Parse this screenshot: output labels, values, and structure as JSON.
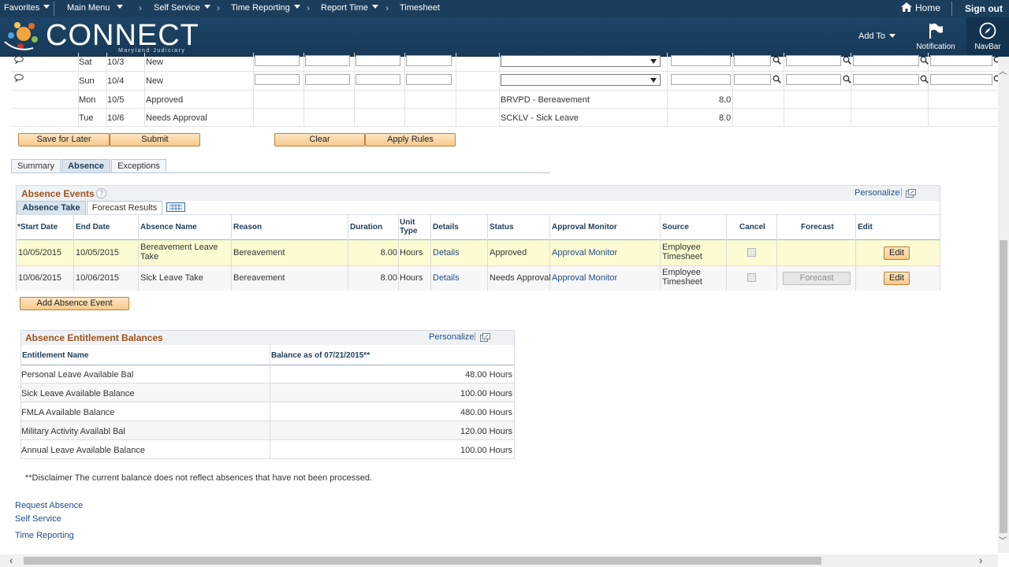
{
  "topnav": {
    "favorites": "Favorites",
    "main_menu": "Main Menu",
    "crumbs": [
      "Self Service",
      "Time Reporting",
      "Report Time",
      "Timesheet"
    ],
    "home": "Home",
    "sign_out": "Sign out"
  },
  "banner": {
    "logo": "CONNECT",
    "logo_sub": "Maryland Judiciary",
    "add_to": "Add To",
    "notification": "Notification",
    "navbar": "NavBar"
  },
  "timesheet_rows": [
    {
      "day": "Sat",
      "date": "10/3",
      "status": "New",
      "editable": true,
      "trc": "",
      "quantity": ""
    },
    {
      "day": "Sun",
      "date": "10/4",
      "status": "New",
      "editable": true,
      "trc": "",
      "quantity": ""
    },
    {
      "day": "Mon",
      "date": "10/5",
      "status": "Approved",
      "editable": false,
      "trc": "BRVPD - Bereavement",
      "quantity": "8.0"
    },
    {
      "day": "Tue",
      "date": "10/6",
      "status": "Needs Approval",
      "editable": false,
      "trc": "SCKLV - Sick Leave",
      "quantity": "8.0"
    }
  ],
  "actions": {
    "save_for_later": "Save for Later",
    "submit": "Submit",
    "clear": "Clear",
    "apply_rules": "Apply Rules"
  },
  "page_tabs": [
    "Summary",
    "Absence",
    "Exceptions"
  ],
  "absence_events": {
    "title": "Absence Events",
    "personalize": "Personalize",
    "subtabs": [
      "Absence Take",
      "Forecast Results"
    ],
    "columns": {
      "start_date": "*Start Date",
      "end_date": "End Date",
      "absence_name": "Absence Name",
      "reason": "Reason",
      "duration": "Duration",
      "unit_type": "Unit Type",
      "details": "Details",
      "status": "Status",
      "approval_monitor": "Approval Monitor",
      "source": "Source",
      "cancel": "Cancel",
      "forecast": "Forecast",
      "edit": "Edit"
    },
    "rows": [
      {
        "start_date": "10/05/2015",
        "end_date": "10/05/2015",
        "absence_name": "Bereavement Leave Take",
        "reason": "Bereavement",
        "duration": "8.00",
        "unit_type": "Hours",
        "details": "Details",
        "status": "Approved",
        "approval_monitor": "Approval Monitor",
        "source": "Employee Timesheet",
        "forecast": "",
        "edit": "Edit"
      },
      {
        "start_date": "10/06/2015",
        "end_date": "10/06/2015",
        "absence_name": "Sick Leave Take",
        "reason": "Bereavement",
        "duration": "8.00",
        "unit_type": "Hours",
        "details": "Details",
        "status": "Needs Approval",
        "approval_monitor": "Approval Monitor",
        "source": "Employee Timesheet",
        "forecast": "Forecast",
        "edit": "Edit"
      }
    ],
    "add_button": "Add Absence Event"
  },
  "entitlements": {
    "title": "Absence Entitlement Balances",
    "personalize": "Personalize",
    "col_name": "Entitlement Name",
    "col_balance": "Balance as of 07/21/2015**",
    "rows": [
      {
        "name": "Personal Leave Available Bal",
        "balance": "48.00 Hours"
      },
      {
        "name": "Sick Leave Available Balance",
        "balance": "100.00 Hours"
      },
      {
        "name": "FMLA Available Balance",
        "balance": "480.00 Hours"
      },
      {
        "name": "Military Activity Availabl Bal",
        "balance": "120.00 Hours"
      },
      {
        "name": "Annual Leave Available Balance",
        "balance": "100.00 Hours"
      }
    ]
  },
  "disclaimer": "**Disclaimer  The current balance does not reflect absences that have not been processed.",
  "footer_links": {
    "request_absence": "Request Absence",
    "self_service": "Self Service",
    "time_reporting": "Time Reporting"
  },
  "colors": {
    "nav_bg": "#1a3e5c",
    "accent_title": "#a0521d",
    "link": "#1f4e8a",
    "highlight_row": "#fdfbd2",
    "button_bg": "#f8c98b"
  },
  "icons": [
    "home-icon",
    "flag-icon",
    "compass-icon",
    "comment-icon",
    "lookup-icon",
    "help-icon",
    "popout-icon",
    "grid-view-icon"
  ]
}
